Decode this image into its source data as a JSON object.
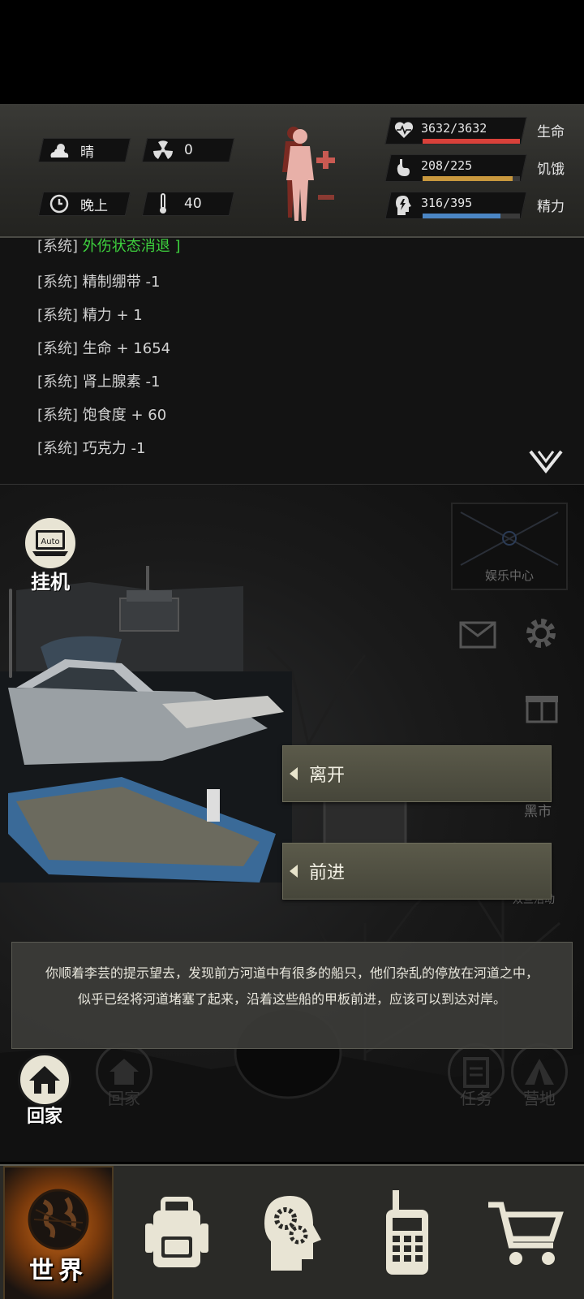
{
  "environment": {
    "weather": "晴",
    "radiation": "0",
    "time_of_day": "晚上",
    "temperature": "40"
  },
  "vitals": [
    {
      "key": "health",
      "value_text": "3632/3632",
      "label": "生命",
      "fraction": 1.0,
      "color": "#d9413a"
    },
    {
      "key": "hunger",
      "value_text": "208/225",
      "label": "饥饿",
      "fraction": 0.924,
      "color": "#c9983e"
    },
    {
      "key": "energy",
      "value_text": "316/395",
      "label": "精力",
      "fraction": 0.8,
      "color": "#4b86c4"
    }
  ],
  "log": {
    "partial_top": {
      "tag": "[系统]",
      "text": "外伤状态消退 ]"
    },
    "lines": [
      {
        "tag": "[系统]",
        "text": "精制绷带 -1"
      },
      {
        "tag": "[系统]",
        "text": "精力 + 1"
      },
      {
        "tag": "[系统]",
        "text": "生命 + 1654"
      },
      {
        "tag": "[系统]",
        "text": "肾上腺素 -1"
      },
      {
        "tag": "[系统]",
        "text": "饱食度 + 60"
      },
      {
        "tag": "[系统]",
        "text": "巧克力 -1"
      }
    ]
  },
  "scene": {
    "auto": {
      "badge": "Auto",
      "label": "挂机"
    },
    "entertainment": "娱乐中心",
    "black_market": "黑市",
    "double_event": "双旦活动",
    "choices": [
      "离开",
      "前进"
    ],
    "narration": "你顺着李芸的提示望去，发现前方河道中有很多的船只，他们杂乱的停放在河道之中，似乎已经将河道堵塞了起来，沿着这些船的甲板前进，应该可以到达对岸。",
    "home_label": "回家",
    "home_bg_label": "回家",
    "task_label": "任务",
    "camp_label": "营地"
  },
  "tabs": [
    {
      "key": "world",
      "label": "世界",
      "icon": "globe-icon",
      "active": true
    },
    {
      "key": "backpack",
      "label": "",
      "icon": "backpack-icon",
      "active": false
    },
    {
      "key": "skills",
      "label": "",
      "icon": "brain-gear-icon",
      "active": false
    },
    {
      "key": "radio",
      "label": "",
      "icon": "walkie-talkie-icon",
      "active": false
    },
    {
      "key": "shop",
      "label": "",
      "icon": "cart-icon",
      "active": false
    }
  ]
}
